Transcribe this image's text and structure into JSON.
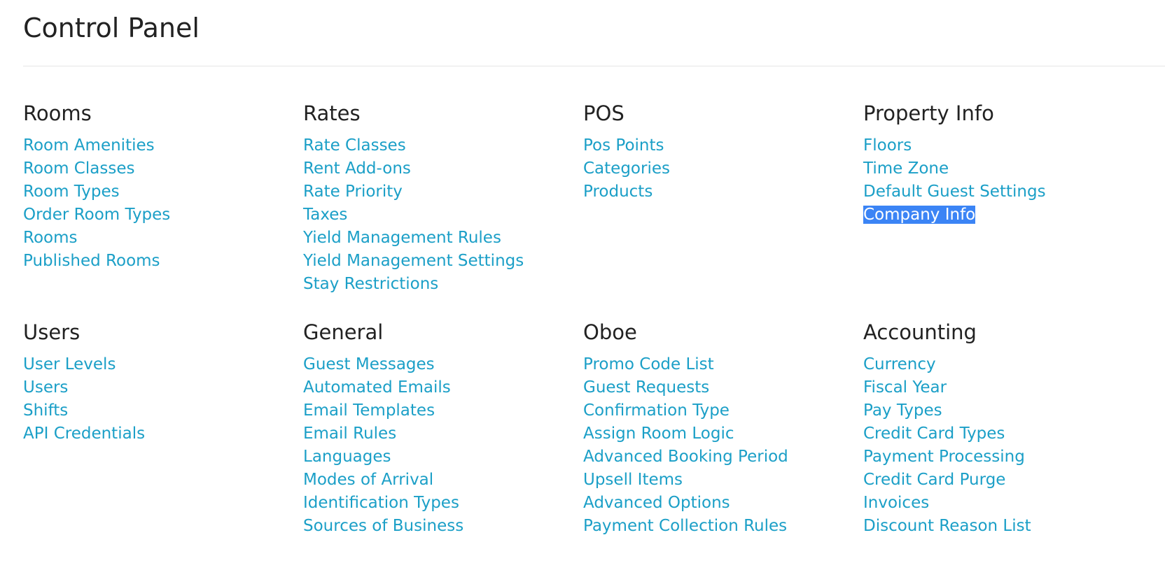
{
  "page": {
    "title": "Control Panel"
  },
  "colors": {
    "link": "#1b9fc7",
    "heading": "#222222",
    "selection": "#3b84f5"
  },
  "sections": {
    "rooms": {
      "heading": "Rooms",
      "items": [
        "Room Amenities",
        "Room Classes",
        "Room Types",
        "Order Room Types",
        "Rooms",
        "Published Rooms"
      ]
    },
    "rates": {
      "heading": "Rates",
      "items": [
        "Rate Classes",
        "Rent Add-ons",
        "Rate Priority",
        "Taxes",
        "Yield Management Rules",
        "Yield Management Settings",
        "Stay Restrictions"
      ]
    },
    "pos": {
      "heading": "POS",
      "items": [
        "Pos Points",
        "Categories",
        "Products"
      ]
    },
    "property_info": {
      "heading": "Property Info",
      "items": [
        "Floors",
        "Time Zone",
        "Default Guest Settings",
        "Company Info"
      ],
      "selected_item": "Company Info"
    },
    "users": {
      "heading": "Users",
      "items": [
        "User Levels",
        "Users",
        "Shifts",
        "API Credentials"
      ]
    },
    "general": {
      "heading": "General",
      "items": [
        "Guest Messages",
        "Automated Emails",
        "Email Templates",
        "Email Rules",
        "Languages",
        "Modes of Arrival",
        "Identification Types",
        "Sources of Business"
      ]
    },
    "oboe": {
      "heading": "Oboe",
      "items": [
        "Promo Code List",
        "Guest Requests",
        "Confirmation Type",
        "Assign Room Logic",
        "Advanced Booking Period",
        "Upsell Items",
        "Advanced Options",
        "Payment Collection Rules"
      ]
    },
    "accounting": {
      "heading": "Accounting",
      "items": [
        "Currency",
        "Fiscal Year",
        "Pay Types",
        "Credit Card Types",
        "Payment Processing",
        "Credit Card Purge",
        "Invoices",
        "Discount Reason List"
      ]
    }
  }
}
